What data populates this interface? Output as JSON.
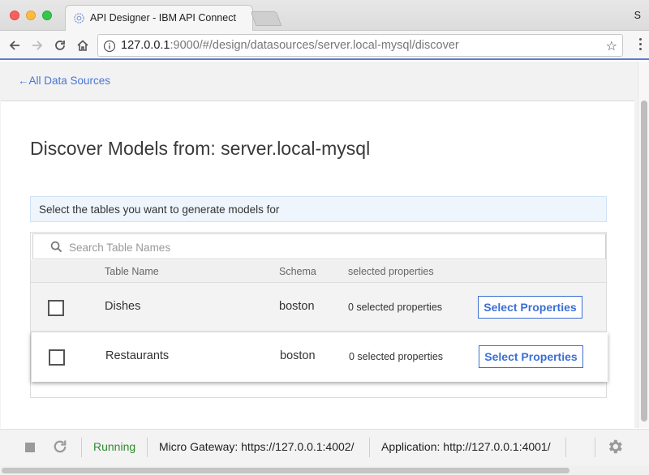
{
  "browser": {
    "tab_title": "API Designer - IBM API Connect",
    "profile_initial": "S",
    "url_host": "127.0.0.1",
    "url_rest": ":9000/#/design/datasources/server.local-mysql/discover"
  },
  "page": {
    "back_link": "All Data Sources",
    "title": "Discover Models from: server.local-mysql",
    "info": "Select the tables you want to generate models for"
  },
  "search": {
    "placeholder": "Search Table Names",
    "value": ""
  },
  "table": {
    "headers": {
      "name": "Table Name",
      "schema": "Schema",
      "props": "selected properties"
    },
    "rows": [
      {
        "name": "Dishes",
        "schema": "boston",
        "props": "0 selected properties",
        "checked": false,
        "button": "Select Properties"
      },
      {
        "name": "Restaurants",
        "schema": "boston",
        "props": "0 selected properties",
        "checked": false,
        "button": "Select Properties"
      }
    ]
  },
  "status": {
    "state": "Running",
    "gateway_label": "Micro Gateway:",
    "gateway_url": "https://127.0.0.1:4002/",
    "app_label": "Application:",
    "app_url": "http://127.0.0.1:4001/"
  },
  "colors": {
    "accent": "#3c6fd4",
    "running": "#2e8b2e",
    "info_bg": "#eef5fd"
  },
  "icons": [
    "api-connect-logo-icon",
    "back-arrow-icon",
    "forward-arrow-icon",
    "reload-icon",
    "home-icon",
    "info-icon",
    "star-icon",
    "menu-icon",
    "search-icon",
    "stop-icon",
    "refresh-icon",
    "gear-icon"
  ]
}
